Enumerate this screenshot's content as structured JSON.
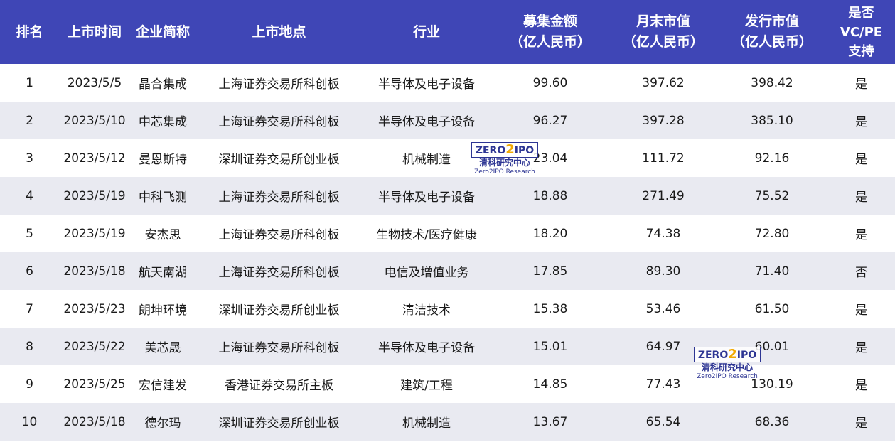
{
  "header": {
    "rank": "排名",
    "date": "上市时间",
    "company": "企业简称",
    "exchange": "上市地点",
    "industry": "行业",
    "raised_l1": "募集金额",
    "raised_l2": "（亿人民币）",
    "month_end_l1": "月末市值",
    "month_end_l2": "（亿人民币）",
    "issue_l1": "发行市值",
    "issue_l2": "（亿人民币）",
    "vc_l1": "是否",
    "vc_l2": "VC/PE",
    "vc_l3": "支持"
  },
  "rows": [
    {
      "rank": "1",
      "date": "2023/5/5",
      "company": "晶合集成",
      "exchange": "上海证券交易所科创板",
      "industry": "半导体及电子设备",
      "raised": "99.60",
      "month_end": "397.62",
      "issue": "398.42",
      "vc": "是"
    },
    {
      "rank": "2",
      "date": "2023/5/10",
      "company": "中芯集成",
      "exchange": "上海证券交易所科创板",
      "industry": "半导体及电子设备",
      "raised": "96.27",
      "month_end": "397.28",
      "issue": "385.10",
      "vc": "是"
    },
    {
      "rank": "3",
      "date": "2023/5/12",
      "company": "曼恩斯特",
      "exchange": "深圳证券交易所创业板",
      "industry": "机械制造",
      "raised": "23.04",
      "month_end": "111.72",
      "issue": "92.16",
      "vc": "是"
    },
    {
      "rank": "4",
      "date": "2023/5/19",
      "company": "中科飞测",
      "exchange": "上海证券交易所科创板",
      "industry": "半导体及电子设备",
      "raised": "18.88",
      "month_end": "271.49",
      "issue": "75.52",
      "vc": "是"
    },
    {
      "rank": "5",
      "date": "2023/5/19",
      "company": "安杰思",
      "exchange": "上海证券交易所科创板",
      "industry": "生物技术/医疗健康",
      "raised": "18.20",
      "month_end": "74.38",
      "issue": "72.80",
      "vc": "是"
    },
    {
      "rank": "6",
      "date": "2023/5/18",
      "company": "航天南湖",
      "exchange": "上海证券交易所科创板",
      "industry": "电信及增值业务",
      "raised": "17.85",
      "month_end": "89.30",
      "issue": "71.40",
      "vc": "否"
    },
    {
      "rank": "7",
      "date": "2023/5/23",
      "company": "朗坤环境",
      "exchange": "深圳证券交易所创业板",
      "industry": "清洁技术",
      "raised": "15.38",
      "month_end": "53.46",
      "issue": "61.50",
      "vc": "是"
    },
    {
      "rank": "8",
      "date": "2023/5/22",
      "company": "美芯晟",
      "exchange": "上海证券交易所科创板",
      "industry": "半导体及电子设备",
      "raised": "15.01",
      "month_end": "64.97",
      "issue": "60.01",
      "vc": "是"
    },
    {
      "rank": "9",
      "date": "2023/5/25",
      "company": "宏信建发",
      "exchange": "香港证券交易所主板",
      "industry": "建筑/工程",
      "raised": "14.85",
      "month_end": "77.43",
      "issue": "130.19",
      "vc": "是"
    },
    {
      "rank": "10",
      "date": "2023/5/18",
      "company": "德尔玛",
      "exchange": "深圳证券交易所创业板",
      "industry": "机械制造",
      "raised": "13.67",
      "month_end": "65.54",
      "issue": "68.36",
      "vc": "是"
    }
  ],
  "watermark": {
    "logo_a": "ZERO",
    "logo_b": "2",
    "logo_c": "IPO",
    "cn": "清科研究中心",
    "en": "Zero2IPO Research"
  },
  "colors": {
    "header_bg": "#3f46b6",
    "stripe": "#e9eaf1",
    "logo_blue": "#2d3593",
    "logo_gold": "#f2a900"
  }
}
